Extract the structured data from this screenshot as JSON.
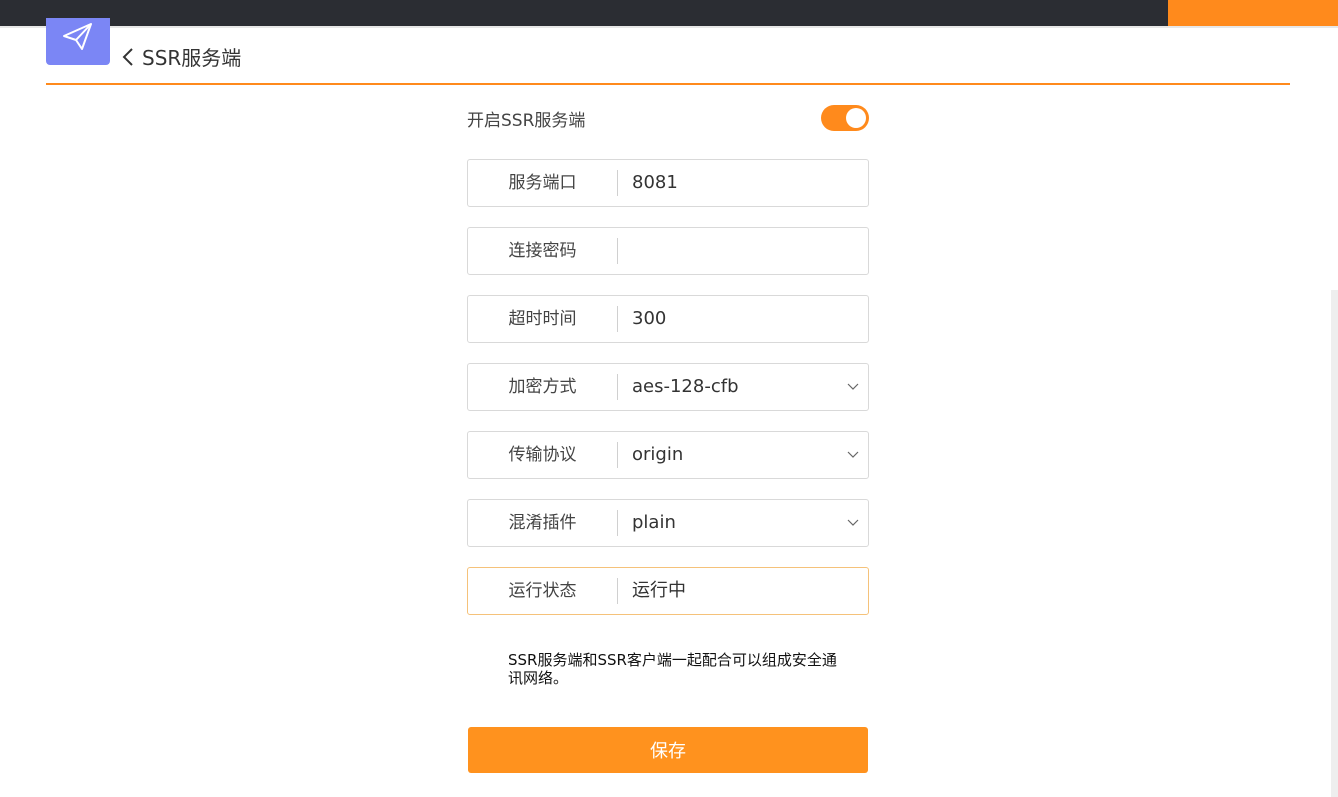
{
  "header": {
    "title": "SSR服务端",
    "back_icon": "chevron-left-icon",
    "app_icon": "paper-plane-icon"
  },
  "enable": {
    "label": "开启SSR服务端",
    "on": true
  },
  "fields": [
    {
      "label": "服务端口",
      "value": "8081"
    },
    {
      "label": "连接密码",
      "value": ""
    },
    {
      "label": "超时时间",
      "value": "300"
    },
    {
      "label": "加密方式",
      "value": "aes-128-cfb"
    },
    {
      "label": "传输协议",
      "value": "origin"
    },
    {
      "label": "混淆插件",
      "value": "plain"
    },
    {
      "label": "运行状态",
      "value": "运行中"
    }
  ],
  "note": "SSR服务端和SSR客户端一起配合可以组成安全通讯网络。",
  "save_label": "保存",
  "colors": {
    "accent": "#ff8a1c",
    "topbar": "#2b2d33",
    "app_icon_bg": "#7b86f5"
  }
}
